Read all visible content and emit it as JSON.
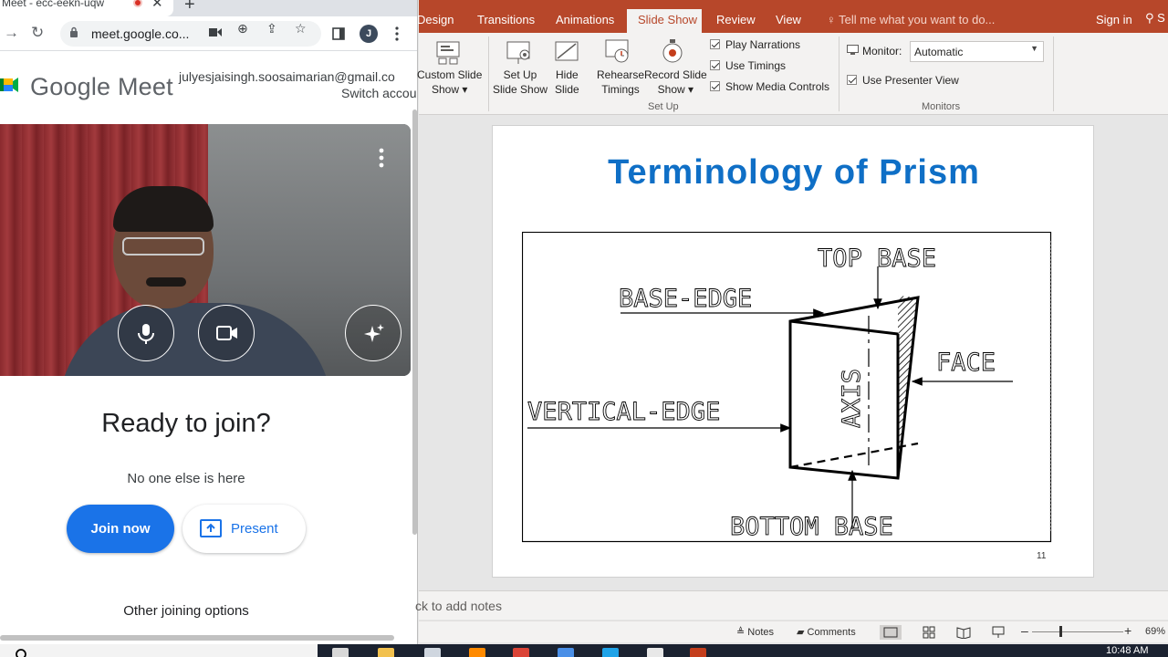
{
  "browser": {
    "tab_title": "Meet - ecc-eekn-uqw",
    "tab_close": "✕",
    "new_tab": "+",
    "url": "meet.google.co...",
    "profile_initial": "J"
  },
  "meet": {
    "brand": "Google Meet",
    "account_email": "julyesjaisingh.soosaimarian@gmail.co",
    "switch_account": "Switch accou",
    "ready_heading": "Ready to join?",
    "status_text": "No one else is here",
    "join_label": "Join now",
    "present_label": "Present",
    "other_options": "Other joining options",
    "brand_colors": {
      "primary": "#1a73e8",
      "danger": "#d93025"
    }
  },
  "ppt": {
    "tabs": [
      "Design",
      "Transitions",
      "Animations",
      "Slide Show",
      "Review",
      "View"
    ],
    "active_tab": "Slide Show",
    "tell_me": "Tell me what you want to do...",
    "sign_in": "Sign in",
    "share": "S",
    "ribbon": {
      "custom_slide_show": [
        "Custom Slide",
        "Show ▾"
      ],
      "set_up_slide_show": [
        "Set Up",
        "Slide Show"
      ],
      "hide_slide": [
        "Hide",
        "Slide"
      ],
      "rehearse_timings": [
        "Rehearse",
        "Timings"
      ],
      "record_slide_show": [
        "Record Slide",
        "Show ▾"
      ],
      "play_narrations": "Play Narrations",
      "use_timings": "Use Timings",
      "show_media_controls": "Show Media Controls",
      "setup_group": "Set Up",
      "monitor_label": "Monitor:",
      "monitor_value": "Automatic",
      "use_presenter_view": "Use Presenter View",
      "monitors_group": "Monitors"
    },
    "slide": {
      "title": "Terminology of Prism",
      "labels": {
        "top_base": "TOP BASE",
        "base_edge": "BASE-EDGE",
        "face": "FACE",
        "vertical_edge": "VERTICAL-EDGE",
        "axis": "AXIS",
        "bottom_base": "BOTTOM BASE"
      },
      "number": "11",
      "title_color": "#0f6fc6"
    },
    "notes_placeholder": "ck to add notes",
    "status": {
      "notes": "Notes",
      "comments": "Comments",
      "zoom": "69%",
      "zoom_minus": "–",
      "zoom_plus": "+"
    },
    "accent": "#b7472a"
  },
  "taskbar": {
    "time": "10:48 AM"
  }
}
